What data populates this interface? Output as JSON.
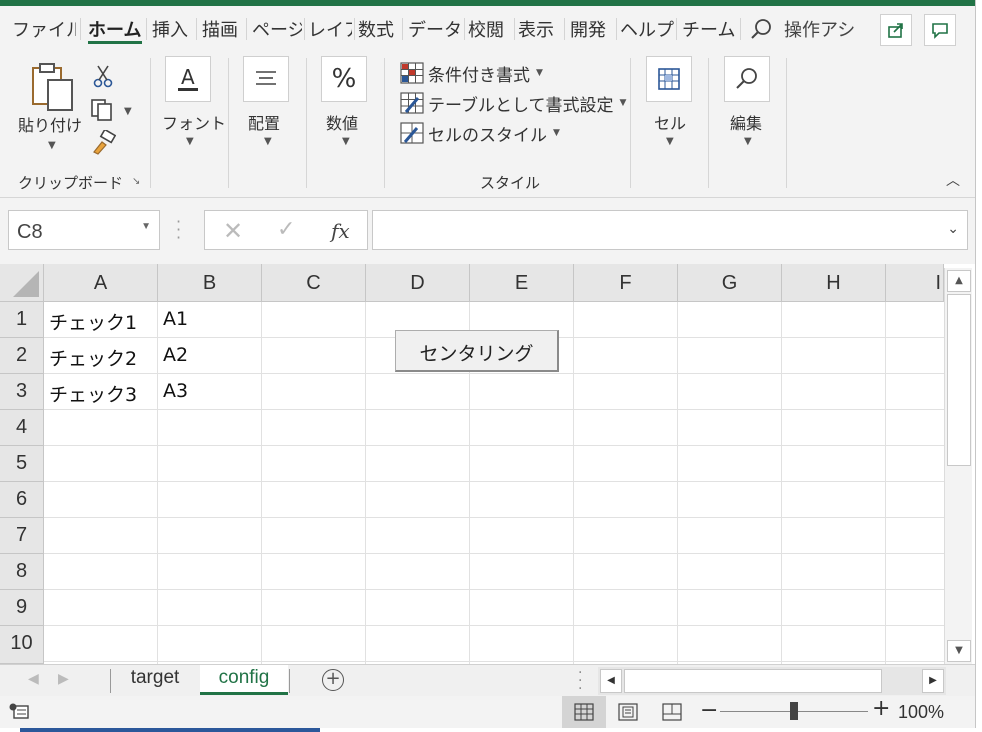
{
  "ribbon_tabs": [
    {
      "label": "ファイル"
    },
    {
      "label": "ホーム"
    },
    {
      "label": "挿入"
    },
    {
      "label": "描画"
    },
    {
      "label": "ページ"
    },
    {
      "label": "レイア"
    },
    {
      "label": "数式"
    },
    {
      "label": "データ"
    },
    {
      "label": "校閲"
    },
    {
      "label": "表示"
    },
    {
      "label": "開発"
    },
    {
      "label": "ヘルプ"
    },
    {
      "label": "チーム"
    }
  ],
  "tell_me": "操作アシ",
  "ribbon": {
    "clipboard": {
      "paste_label": "貼り付け",
      "group_label": "クリップボード"
    },
    "font": {
      "label": "フォント"
    },
    "alignment": {
      "label": "配置"
    },
    "number": {
      "label": "数値"
    },
    "styles": {
      "conditional": "条件付き書式",
      "as_table": "テーブルとして書式設定",
      "cell_styles": "セルのスタイル",
      "group_label": "スタイル"
    },
    "cells": {
      "label": "セル"
    },
    "editing": {
      "label": "編集"
    }
  },
  "formula_bar": {
    "name_box": "C8",
    "formula": ""
  },
  "grid": {
    "columns": [
      "A",
      "B",
      "C",
      "D",
      "E",
      "F",
      "G",
      "H",
      "I"
    ],
    "rows": [
      "1",
      "2",
      "3",
      "4",
      "5",
      "6",
      "7",
      "8",
      "9",
      "10"
    ],
    "cells": [
      {
        "ref": "A1",
        "value": "チェック1"
      },
      {
        "ref": "B1",
        "value": "A1"
      },
      {
        "ref": "A2",
        "value": "チェック2"
      },
      {
        "ref": "B2",
        "value": "A2"
      },
      {
        "ref": "A3",
        "value": "チェック3"
      },
      {
        "ref": "B3",
        "value": "A3"
      }
    ]
  },
  "sheet_button": {
    "label": "センタリング"
  },
  "sheets": [
    {
      "name": "target",
      "active": false
    },
    {
      "name": "config",
      "active": true
    }
  ],
  "status": {
    "zoom": "100%",
    "zoom_percent": 100
  },
  "colors": {
    "accent": "#217346"
  }
}
